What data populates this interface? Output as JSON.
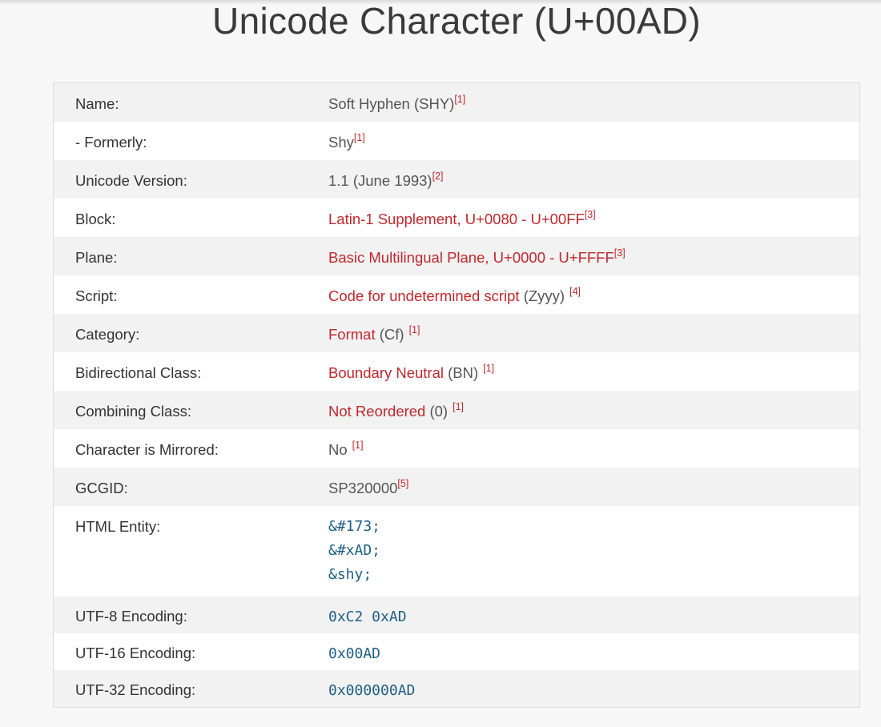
{
  "page": {
    "title": "Unicode Character (U+00AD)"
  },
  "properties": {
    "name": {
      "label": "Name:",
      "value": "Soft Hyphen (SHY)",
      "ref": "[1]"
    },
    "formerly": {
      "label": "- Formerly:",
      "value": "Shy",
      "ref": "[1]"
    },
    "unicode_version": {
      "label": "Unicode Version:",
      "value": "1.1 (June 1993)",
      "ref": "[2]"
    },
    "block": {
      "label": "Block:",
      "link": "Latin-1 Supplement, U+0080 - U+00FF",
      "ref": "[3]"
    },
    "plane": {
      "label": "Plane:",
      "link": "Basic Multilingual Plane, U+0000 - U+FFFF",
      "ref": "[3]"
    },
    "script": {
      "label": "Script:",
      "link": "Code for undetermined script",
      "code": " (Zyyy)",
      "ref": "[4]"
    },
    "category": {
      "label": "Category:",
      "link": "Format",
      "code": " (Cf)",
      "ref": "[1]"
    },
    "bidirectional_class": {
      "label": "Bidirectional Class:",
      "link": "Boundary Neutral",
      "code": " (BN)",
      "ref": "[1]"
    },
    "combining_class": {
      "label": "Combining Class:",
      "link": "Not Reordered",
      "code": " (0)",
      "ref": "[1]"
    },
    "mirrored": {
      "label": "Character is Mirrored:",
      "value": "No",
      "ref": "[1]"
    },
    "gcgid": {
      "label": "GCGID:",
      "value": "SP320000",
      "ref": "[5]"
    },
    "html_entity": {
      "label": "HTML Entity:",
      "values": [
        "&#173;",
        "&#xAD;",
        "&shy;"
      ]
    },
    "utf8": {
      "label": "UTF-8 Encoding:",
      "value": "0xC2 0xAD"
    },
    "utf16": {
      "label": "UTF-16 Encoding:",
      "value": "0x00AD"
    },
    "utf32": {
      "label": "UTF-32 Encoding:",
      "value": "0x000000AD"
    }
  },
  "colors": {
    "link": "#c0282d",
    "code": "#1f5f85",
    "stripe": "#f2f2f2"
  }
}
